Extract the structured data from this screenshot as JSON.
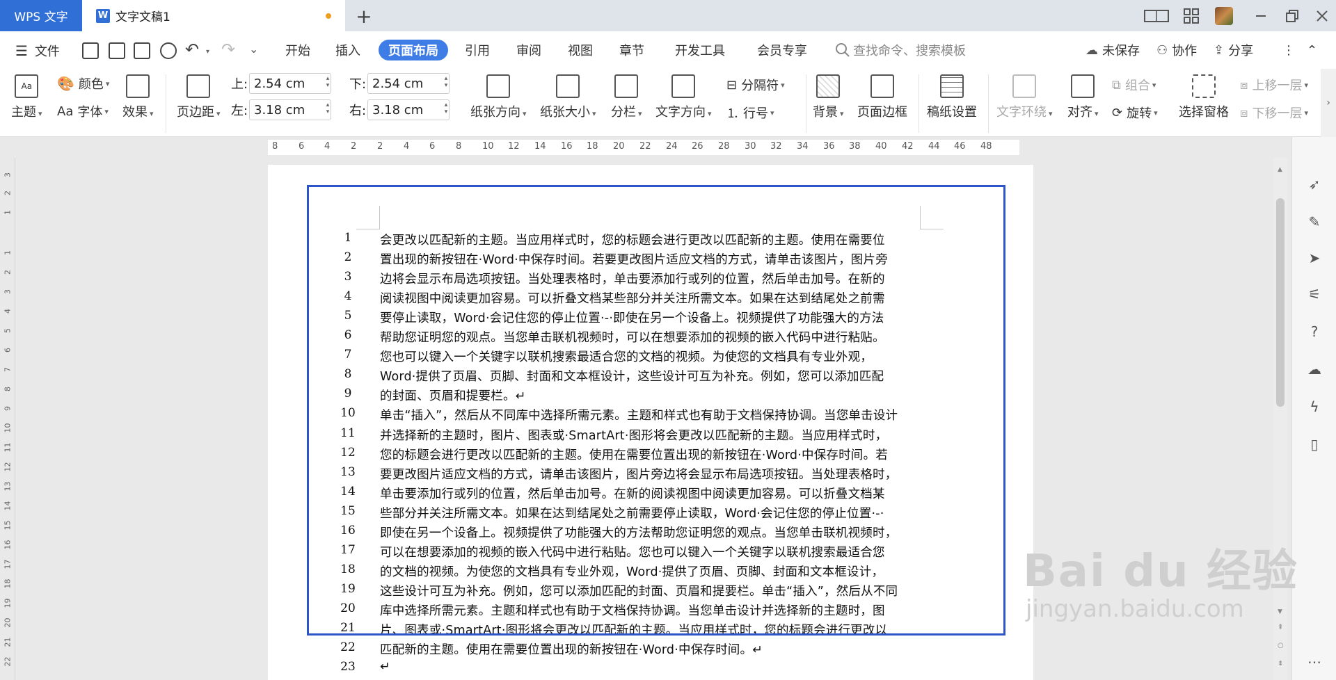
{
  "titlebar": {
    "app_tab": "WPS 文字",
    "doc_tab": "文字文稿1",
    "new_tab": "+"
  },
  "menubar": {
    "file": "文件",
    "tabs": [
      "开始",
      "插入",
      "页面布局",
      "引用",
      "审阅",
      "视图",
      "章节",
      "开发工具",
      "会员专享"
    ],
    "active_tab": "页面布局",
    "search_placeholder": "查找命令、搜索模板",
    "unsaved": "未保存",
    "collab": "协作",
    "share": "分享"
  },
  "ribbon": {
    "theme": "主题",
    "color": "颜色",
    "font": "字体",
    "effect": "效果",
    "margins": "页边距",
    "margin_top_label": "上:",
    "margin_top": "2.54 cm",
    "margin_bottom_label": "下:",
    "margin_bottom": "2.54 cm",
    "margin_left_label": "左:",
    "margin_left": "3.18 cm",
    "margin_right_label": "右:",
    "margin_right": "3.18 cm",
    "orientation": "纸张方向",
    "paper_size": "纸张大小",
    "columns": "分栏",
    "text_direction": "文字方向",
    "breaks": "分隔符",
    "line_numbers": "行号",
    "background": "背景",
    "page_border": "页面边框",
    "manuscript": "稿纸设置",
    "text_wrap": "文字环绕",
    "align": "对齐",
    "group": "组合",
    "rotate": "旋转",
    "selection_pane": "选择窗格",
    "bring_forward": "上移一层",
    "send_backward": "下移一层"
  },
  "ruler": {
    "h_ticks": [
      "8",
      "6",
      "4",
      "2",
      "2",
      "4",
      "6",
      "8",
      "10",
      "12",
      "14",
      "16",
      "18",
      "20",
      "22",
      "24",
      "26",
      "28",
      "30",
      "32",
      "34",
      "36",
      "38",
      "40",
      "42",
      "44",
      "46",
      "48"
    ],
    "v_ticks": [
      "3",
      "2",
      "1",
      "1",
      "2",
      "3",
      "4",
      "5",
      "6",
      "7",
      "8",
      "9",
      "10",
      "11",
      "12",
      "13",
      "14",
      "15",
      "16",
      "17",
      "18",
      "19",
      "20",
      "21",
      "22"
    ]
  },
  "document": {
    "lines": [
      {
        "no": "1",
        "text": "会更改以匹配新的主题。当应用样式时，您的标题会进行更改以匹配新的主题。使用在需要位"
      },
      {
        "no": "2",
        "text": "置出现的新按钮在·Word·中保存时间。若要更改图片适应文档的方式，请单击该图片，图片旁"
      },
      {
        "no": "3",
        "text": "边将会显示布局选项按钮。当处理表格时，单击要添加行或列的位置，然后单击加号。在新的"
      },
      {
        "no": "4",
        "text": "阅读视图中阅读更加容易。可以折叠文档某些部分并关注所需文本。如果在达到结尾处之前需"
      },
      {
        "no": "5",
        "text": "要停止读取，Word·会记住您的停止位置·-·即使在另一个设备上。视频提供了功能强大的方法"
      },
      {
        "no": "6",
        "text": "帮助您证明您的观点。当您单击联机视频时，可以在想要添加的视频的嵌入代码中进行粘贴。"
      },
      {
        "no": "7",
        "text": "您也可以键入一个关键字以联机搜索最适合您的文档的视频。为使您的文档具有专业外观，"
      },
      {
        "no": "8",
        "text": "Word·提供了页眉、页脚、封面和文本框设计，这些设计可互为补充。例如，您可以添加匹配"
      },
      {
        "no": "9",
        "text": "的封面、页眉和提要栏。↵"
      },
      {
        "no": "10",
        "text": "单击“插入”，然后从不同库中选择所需元素。主题和样式也有助于文档保持协调。当您单击设计"
      },
      {
        "no": "11",
        "text": "并选择新的主题时，图片、图表或·SmartArt·图形将会更改以匹配新的主题。当应用样式时，"
      },
      {
        "no": "12",
        "text": "您的标题会进行更改以匹配新的主题。使用在需要位置出现的新按钮在·Word·中保存时间。若"
      },
      {
        "no": "13",
        "text": "要更改图片适应文档的方式，请单击该图片，图片旁边将会显示布局选项按钮。当处理表格时，"
      },
      {
        "no": "14",
        "text": "单击要添加行或列的位置，然后单击加号。在新的阅读视图中阅读更加容易。可以折叠文档某"
      },
      {
        "no": "15",
        "text": "些部分并关注所需文本。如果在达到结尾处之前需要停止读取，Word·会记住您的停止位置·-·"
      },
      {
        "no": "16",
        "text": "即使在另一个设备上。视频提供了功能强大的方法帮助您证明您的观点。当您单击联机视频时，"
      },
      {
        "no": "17",
        "text": "可以在想要添加的视频的嵌入代码中进行粘贴。您也可以键入一个关键字以联机搜索最适合您"
      },
      {
        "no": "18",
        "text": "的文档的视频。为使您的文档具有专业外观，Word·提供了页眉、页脚、封面和文本框设计，"
      },
      {
        "no": "19",
        "text": "这些设计可互为补充。例如，您可以添加匹配的封面、页眉和提要栏。单击“插入”，然后从不同"
      },
      {
        "no": "20",
        "text": "库中选择所需元素。主题和样式也有助于文档保持协调。当您单击设计并选择新的主题时，图"
      },
      {
        "no": "21",
        "text": "片、图表或·SmartArt·图形将会更改以匹配新的主题。当应用样式时，您的标题会进行更改以"
      },
      {
        "no": "22",
        "text": "匹配新的主题。使用在需要位置出现的新按钮在·Word·中保存时间。↵"
      },
      {
        "no": "23",
        "text": "↵"
      }
    ]
  },
  "watermark": {
    "brand": "Bai du 经验",
    "url": "jingyan.baidu.com"
  },
  "colors": {
    "accent": "#3e7ce6",
    "app_tab": "#2f6fd6",
    "selection_frame": "#2d54c9",
    "unsaved_dot": "#f0a020"
  }
}
